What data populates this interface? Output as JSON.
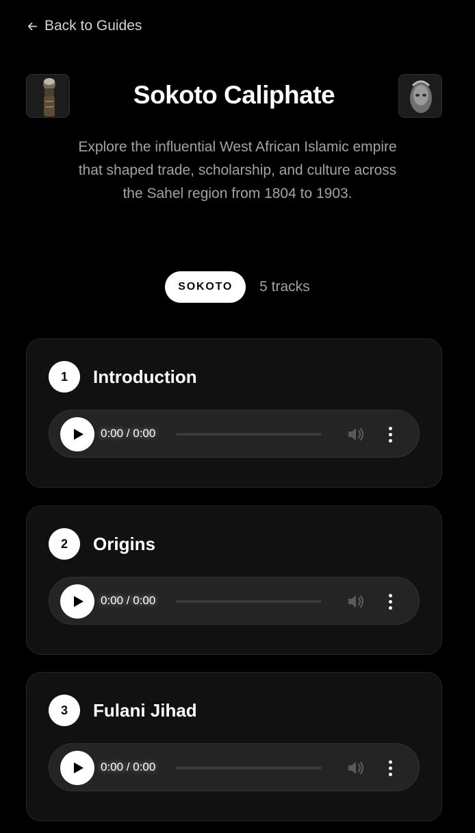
{
  "nav": {
    "back_label": "Back to Guides"
  },
  "header": {
    "title": "Sokoto Caliphate",
    "description": "Explore the influential West African Islamic empire that shaped trade, scholarship, and culture across the Sahel region from 1804 to 1903."
  },
  "meta": {
    "tag": "SOKOTO",
    "track_count": "5 tracks"
  },
  "tracks": [
    {
      "number": "1",
      "title": "Introduction",
      "time": "0:00 / 0:00"
    },
    {
      "number": "2",
      "title": "Origins",
      "time": "0:00 / 0:00"
    },
    {
      "number": "3",
      "title": "Fulani Jihad",
      "time": "0:00 / 0:00"
    }
  ],
  "icons": {
    "back": "arrow-left-icon",
    "play": "play-icon",
    "volume": "volume-icon",
    "menu": "more-vertical-icon"
  },
  "colors": {
    "background": "#000000",
    "card": "#111111",
    "accent": "#ffffff",
    "muted_text": "#a3a3a3"
  }
}
